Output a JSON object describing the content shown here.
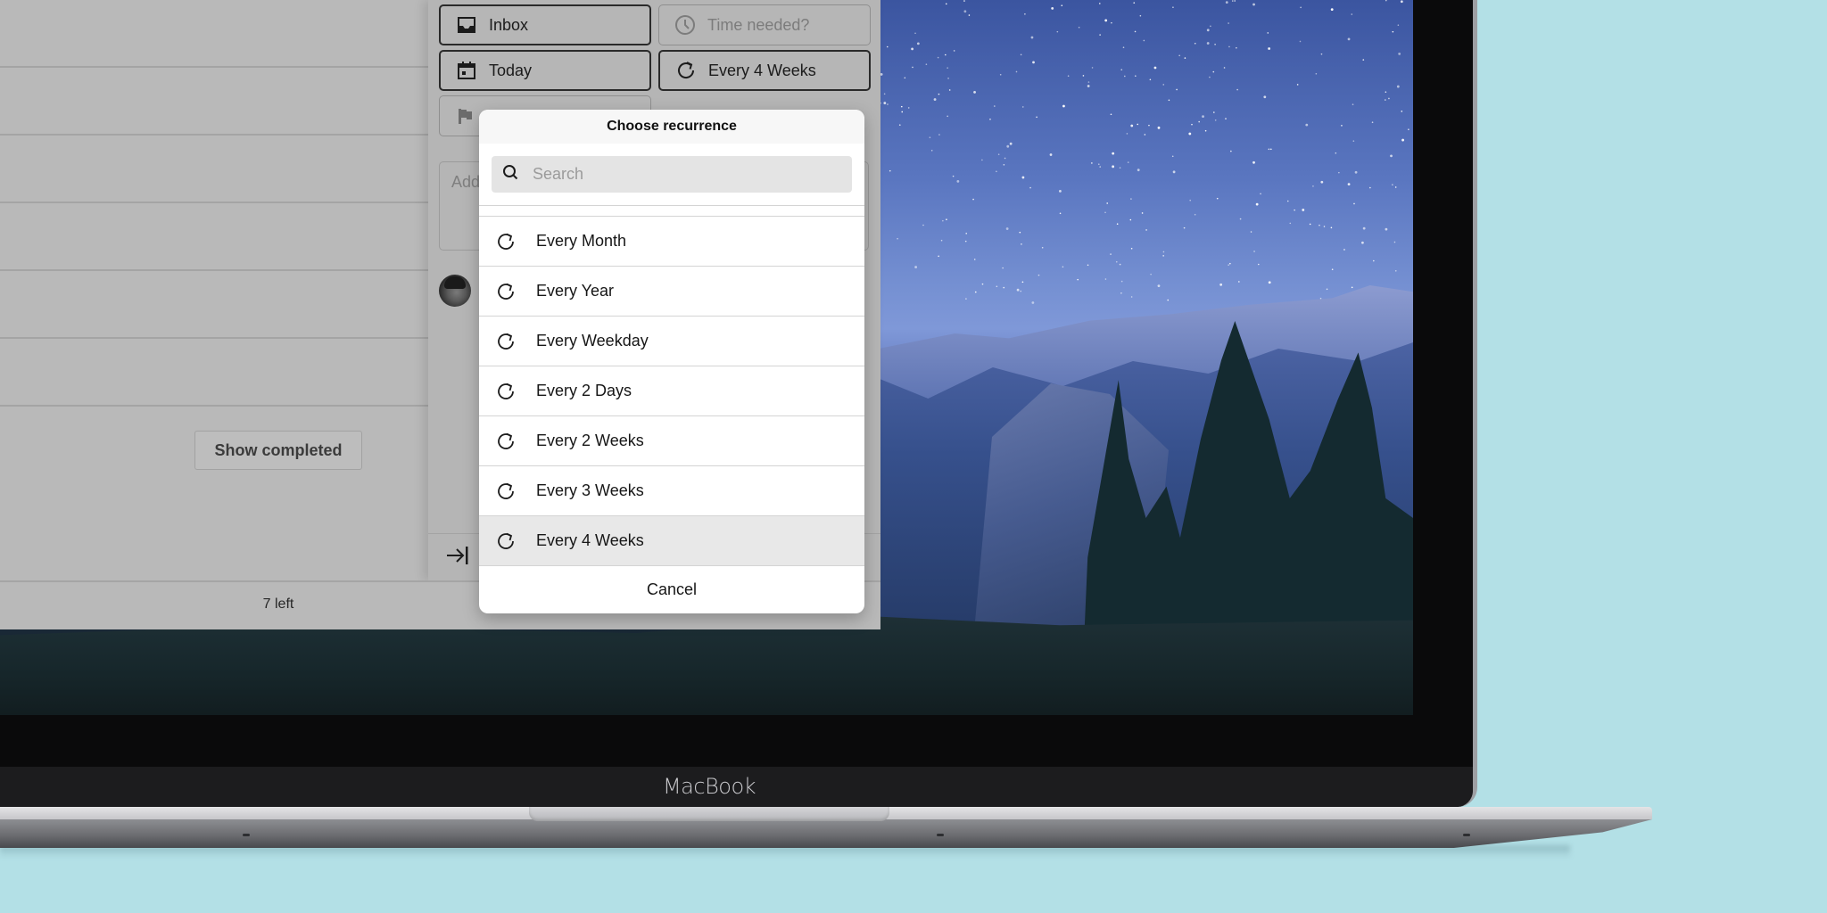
{
  "device": {
    "brand_label": "MacBook",
    "background_color": "#b3e0e6"
  },
  "app": {
    "task_list": {
      "row_count": 6,
      "show_completed_label": "Show completed",
      "remaining_label": "7 left"
    },
    "detail": {
      "chips": {
        "list": {
          "label": "Inbox",
          "icon": "inbox-tray-icon"
        },
        "time": {
          "placeholder": "Time needed?",
          "icon": "clock-icon"
        },
        "date": {
          "label": "Today",
          "icon": "calendar-icon"
        },
        "recurrence": {
          "label": "Every 4 Weeks",
          "icon": "repeat-icon"
        },
        "priority": {
          "icon": "flag-icon"
        }
      },
      "notes_placeholder": "Add",
      "collapse_icon": "collapse-arrow-icon"
    }
  },
  "recurrence_popover": {
    "title": "Choose recurrence",
    "search_placeholder": "Search",
    "search_value": "",
    "options": [
      {
        "label": "Every Month",
        "selected": false
      },
      {
        "label": "Every Year",
        "selected": false
      },
      {
        "label": "Every Weekday",
        "selected": false
      },
      {
        "label": "Every 2 Days",
        "selected": false
      },
      {
        "label": "Every 2 Weeks",
        "selected": false
      },
      {
        "label": "Every 3 Weeks",
        "selected": false
      },
      {
        "label": "Every 4 Weeks",
        "selected": true
      }
    ],
    "cancel_label": "Cancel"
  }
}
